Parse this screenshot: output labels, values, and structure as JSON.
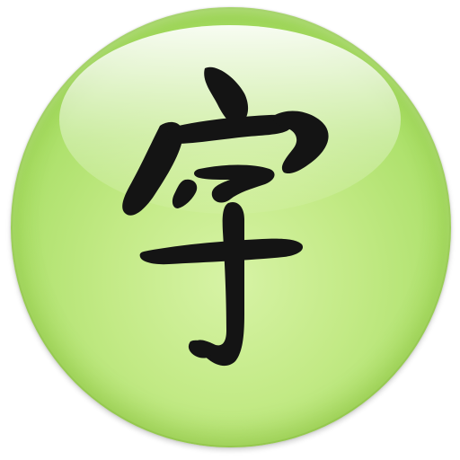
{
  "app": {
    "icon_name": "chinese-character-icon",
    "glyph": "字"
  },
  "colors": {
    "orb_light": "#d7f3a6",
    "orb_mid": "#ace06a",
    "orb_edge": "#86c43d",
    "ink": "#141414"
  }
}
